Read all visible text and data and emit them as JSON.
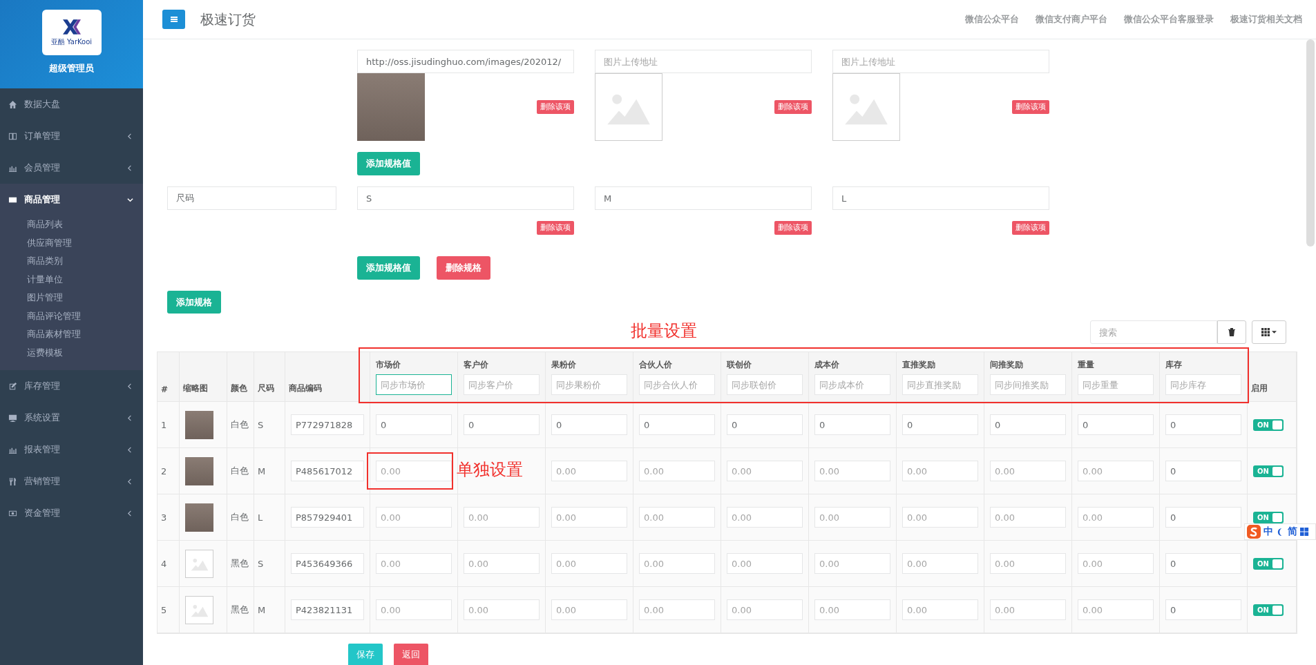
{
  "sidebar": {
    "logo_text": "亚酷 YarKooi",
    "role": "超级管理员",
    "menu": [
      {
        "label": "数据大盘"
      },
      {
        "label": "订单管理",
        "expanded": false
      },
      {
        "label": "会员管理",
        "expanded": false
      },
      {
        "label": "商品管理",
        "expanded": true,
        "children": [
          "商品列表",
          "供应商管理",
          "商品类别",
          "计量单位",
          "图片管理",
          "商品评论管理",
          "商品素材管理",
          "运费模板"
        ]
      },
      {
        "label": "库存管理",
        "expanded": false
      },
      {
        "label": "系统设置",
        "expanded": false
      },
      {
        "label": "报表管理",
        "expanded": false
      },
      {
        "label": "营销管理",
        "expanded": false
      },
      {
        "label": "资金管理",
        "expanded": false
      }
    ]
  },
  "header": {
    "title": "极速订货",
    "links": [
      "微信公众平台",
      "微信支付商户平台",
      "微信公众平台客服登录",
      "极速订货相关文档"
    ]
  },
  "specs": [
    {
      "values": [
        {
          "kind": "photo",
          "value": "http://oss.jisudinghuo.com/images/202012/",
          "delete": "删除该项"
        },
        {
          "kind": "empty",
          "placeholder": "图片上传地址",
          "delete": "删除该项"
        },
        {
          "kind": "empty",
          "placeholder": "图片上传地址",
          "delete": "删除该项"
        }
      ],
      "buttons": [
        {
          "label": "添加规格值",
          "kind": "add"
        }
      ]
    },
    {
      "name": "尺码",
      "values": [
        {
          "kind": "text",
          "value": "S",
          "delete": "删除该项"
        },
        {
          "kind": "text",
          "value": "M",
          "delete": "删除该项"
        },
        {
          "kind": "text",
          "value": "L",
          "delete": "删除该项"
        }
      ],
      "buttons": [
        {
          "label": "添加规格值",
          "kind": "add"
        },
        {
          "label": "删除规格",
          "kind": "delete"
        }
      ]
    }
  ],
  "add_spec_button": "添加规格",
  "toolbar": {
    "search_placeholder": "搜索"
  },
  "table": {
    "columns": [
      {
        "label": "#",
        "kind": "text"
      },
      {
        "label": "缩略图",
        "kind": "text"
      },
      {
        "label": "颜色",
        "kind": "text"
      },
      {
        "label": "尺码",
        "kind": "text"
      },
      {
        "label": "商品编码",
        "kind": "text"
      },
      {
        "label": "市场价",
        "kind": "batch",
        "placeholder": "同步市场价",
        "focused": true
      },
      {
        "label": "客户价",
        "kind": "batch",
        "placeholder": "同步客户价",
        "focused": false
      },
      {
        "label": "果粉价",
        "kind": "batch",
        "placeholder": "同步果粉价",
        "focused": false
      },
      {
        "label": "合伙人价",
        "kind": "batch",
        "placeholder": "同步合伙人价",
        "focused": false
      },
      {
        "label": "联创价",
        "kind": "batch",
        "placeholder": "同步联创价",
        "focused": false
      },
      {
        "label": "成本价",
        "kind": "batch",
        "placeholder": "同步成本价",
        "focused": false
      },
      {
        "label": "直推奖励",
        "kind": "batch",
        "placeholder": "同步直推奖励",
        "focused": false
      },
      {
        "label": "间推奖励",
        "kind": "batch",
        "placeholder": "同步间推奖励",
        "focused": false
      },
      {
        "label": "重量",
        "kind": "batch",
        "placeholder": "同步重量",
        "focused": false
      },
      {
        "label": "库存",
        "kind": "batch",
        "placeholder": "同步库存",
        "focused": false
      },
      {
        "label": "启用",
        "kind": "text"
      }
    ],
    "rows": [
      {
        "cells": [
          {
            "kind": "text",
            "text": "1"
          },
          {
            "kind": "photo"
          },
          {
            "kind": "text",
            "text": "白色"
          },
          {
            "kind": "text",
            "text": "S"
          },
          {
            "kind": "input",
            "value": "P772971828"
          },
          {
            "kind": "input",
            "value": "0"
          },
          {
            "kind": "input",
            "value": "0"
          },
          {
            "kind": "input",
            "value": "0"
          },
          {
            "kind": "input",
            "value": "0"
          },
          {
            "kind": "input",
            "value": "0"
          },
          {
            "kind": "input",
            "value": "0"
          },
          {
            "kind": "input",
            "value": "0"
          },
          {
            "kind": "input",
            "value": "0"
          },
          {
            "kind": "input",
            "value": "0"
          },
          {
            "kind": "input",
            "value": "0"
          },
          {
            "kind": "toggle",
            "on": true,
            "text": "ON"
          }
        ]
      },
      {
        "cells": [
          {
            "kind": "text",
            "text": "2"
          },
          {
            "kind": "photo"
          },
          {
            "kind": "text",
            "text": "白色"
          },
          {
            "kind": "text",
            "text": "M"
          },
          {
            "kind": "input",
            "value": "P485617012"
          },
          {
            "kind": "input",
            "placeholder": "0.00"
          },
          {
            "kind": "covered"
          },
          {
            "kind": "input",
            "placeholder": "0.00"
          },
          {
            "kind": "input",
            "placeholder": "0.00"
          },
          {
            "kind": "input",
            "placeholder": "0.00"
          },
          {
            "kind": "input",
            "placeholder": "0.00"
          },
          {
            "kind": "input",
            "placeholder": "0.00"
          },
          {
            "kind": "input",
            "placeholder": "0.00"
          },
          {
            "kind": "input",
            "placeholder": "0.00"
          },
          {
            "kind": "input",
            "value": "0"
          },
          {
            "kind": "toggle",
            "on": true,
            "text": "ON"
          }
        ]
      },
      {
        "cells": [
          {
            "kind": "text",
            "text": "3"
          },
          {
            "kind": "photo"
          },
          {
            "kind": "text",
            "text": "白色"
          },
          {
            "kind": "text",
            "text": "L"
          },
          {
            "kind": "input",
            "value": "P857929401"
          },
          {
            "kind": "input",
            "placeholder": "0.00"
          },
          {
            "kind": "input",
            "placeholder": "0.00"
          },
          {
            "kind": "input",
            "placeholder": "0.00"
          },
          {
            "kind": "input",
            "placeholder": "0.00"
          },
          {
            "kind": "input",
            "placeholder": "0.00"
          },
          {
            "kind": "input",
            "placeholder": "0.00"
          },
          {
            "kind": "input",
            "placeholder": "0.00"
          },
          {
            "kind": "input",
            "placeholder": "0.00"
          },
          {
            "kind": "input",
            "placeholder": "0.00"
          },
          {
            "kind": "input",
            "value": "0"
          },
          {
            "kind": "toggle",
            "on": true,
            "text": "ON"
          }
        ]
      },
      {
        "cells": [
          {
            "kind": "text",
            "text": "4"
          },
          {
            "kind": "empty"
          },
          {
            "kind": "text",
            "text": "黑色"
          },
          {
            "kind": "text",
            "text": "S"
          },
          {
            "kind": "input",
            "value": "P453649366"
          },
          {
            "kind": "input",
            "placeholder": "0.00"
          },
          {
            "kind": "input",
            "placeholder": "0.00"
          },
          {
            "kind": "input",
            "placeholder": "0.00"
          },
          {
            "kind": "input",
            "placeholder": "0.00"
          },
          {
            "kind": "input",
            "placeholder": "0.00"
          },
          {
            "kind": "input",
            "placeholder": "0.00"
          },
          {
            "kind": "input",
            "placeholder": "0.00"
          },
          {
            "kind": "input",
            "placeholder": "0.00"
          },
          {
            "kind": "input",
            "placeholder": "0.00"
          },
          {
            "kind": "input",
            "value": "0"
          },
          {
            "kind": "toggle",
            "on": true,
            "text": "ON"
          }
        ]
      },
      {
        "cells": [
          {
            "kind": "text",
            "text": "5"
          },
          {
            "kind": "empty"
          },
          {
            "kind": "text",
            "text": "黑色"
          },
          {
            "kind": "text",
            "text": "M"
          },
          {
            "kind": "input",
            "value": "P423821131"
          },
          {
            "kind": "input",
            "placeholder": "0.00"
          },
          {
            "kind": "input",
            "placeholder": "0.00"
          },
          {
            "kind": "input",
            "placeholder": "0.00"
          },
          {
            "kind": "input",
            "placeholder": "0.00"
          },
          {
            "kind": "input",
            "placeholder": "0.00"
          },
          {
            "kind": "input",
            "placeholder": "0.00"
          },
          {
            "kind": "input",
            "placeholder": "0.00"
          },
          {
            "kind": "input",
            "placeholder": "0.00"
          },
          {
            "kind": "input",
            "placeholder": "0.00"
          },
          {
            "kind": "input",
            "value": "0"
          },
          {
            "kind": "toggle",
            "on": true,
            "text": "ON"
          }
        ]
      }
    ]
  },
  "annotations": [
    {
      "kind": "batch",
      "text": "批量设置"
    },
    {
      "kind": "single",
      "text": "单独设置"
    }
  ],
  "footer": {
    "buttons": [
      {
        "label": "保存",
        "kind": "save"
      },
      {
        "label": "返回",
        "kind": "back"
      }
    ]
  },
  "ime": {
    "items": [
      "中",
      "简"
    ]
  }
}
